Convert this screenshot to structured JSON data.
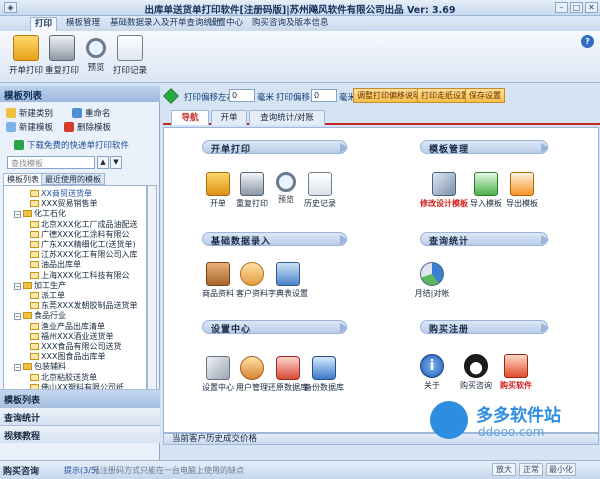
{
  "app": {
    "title": "出库单送货单打印软件[注册码版]|苏州飚风软件有限公司出品  Ver: 3.69"
  },
  "ribbon": {
    "tabs": [
      "打印",
      "模板管理",
      "基础数据录入及开单查询统计",
      "设置中心",
      "购买咨询及版本信息"
    ],
    "buttons": [
      {
        "label": "开单打印",
        "icon": "folder-print-icon"
      },
      {
        "label": "重复打印",
        "icon": "printer-icon"
      },
      {
        "label": "预览",
        "icon": "magnifier-icon"
      },
      {
        "label": "打印记录",
        "icon": "clipboard-icon"
      }
    ]
  },
  "left_panel": {
    "header": "模板列表",
    "actions": [
      "新建类别",
      "重命名",
      "新建模板",
      "删除模板"
    ],
    "download_link": "下载免费的快递单打印软件",
    "search_placeholder": "查找模板",
    "subtabs": [
      "模板列表",
      "最近使用的模板"
    ],
    "tree": [
      {
        "text": "XX商贸送货单",
        "level": 2,
        "type": "file"
      },
      {
        "text": "XXX贸易销售单",
        "level": 2,
        "type": "file"
      },
      {
        "text": "化工石化",
        "level": 1,
        "type": "folder"
      },
      {
        "text": "北京XXX化工厂成品油配送",
        "level": 2,
        "type": "file"
      },
      {
        "text": "广德XXX化工涂料有限公",
        "level": 2,
        "type": "file"
      },
      {
        "text": "广东XXX精细化工(送货单)",
        "level": 2,
        "type": "file"
      },
      {
        "text": "江苏XXX化工有限公司入库",
        "level": 2,
        "type": "file"
      },
      {
        "text": "油品出库单",
        "level": 2,
        "type": "file"
      },
      {
        "text": "上海XXX化工科技有限公",
        "level": 2,
        "type": "file"
      },
      {
        "text": "加工生产",
        "level": 1,
        "type": "folder"
      },
      {
        "text": "派工单",
        "level": 2,
        "type": "file"
      },
      {
        "text": "东莞XXX发朝胶制品送货单",
        "level": 2,
        "type": "file"
      },
      {
        "text": "食品行业",
        "level": 1,
        "type": "folder"
      },
      {
        "text": "渔业产品出库清单",
        "level": 2,
        "type": "file"
      },
      {
        "text": "福州XXX酒业送货单",
        "level": 2,
        "type": "file"
      },
      {
        "text": "XXX食品有限公司送货",
        "level": 2,
        "type": "file"
      },
      {
        "text": "XXX图食品出库单",
        "level": 2,
        "type": "file"
      },
      {
        "text": "包装辅料",
        "level": 1,
        "type": "folder"
      },
      {
        "text": "北京粘胶送货单",
        "level": 2,
        "type": "file"
      },
      {
        "text": "佛山XX塑料有限公司纸",
        "level": 2,
        "type": "file"
      }
    ],
    "sections": [
      "模板列表",
      "查询统计",
      "视频教程"
    ]
  },
  "print_options": {
    "left_right_label": "打印偏移左右",
    "left_right_value": "0",
    "up_down_label": "打印偏移上下",
    "up_down_value": "0",
    "unit": "毫米",
    "buttons": [
      "调整打印偏移说明",
      "打印走纸设置",
      "保存设置"
    ]
  },
  "main_tabs": [
    "导航",
    "开单",
    "查询统计/对账"
  ],
  "sections": {
    "kaidan": {
      "title": "开单打印",
      "items": [
        "开单",
        "重复打印",
        "预览",
        "历史记录"
      ]
    },
    "moban": {
      "title": "模板管理",
      "items": [
        "修改设计模板",
        "导入模板",
        "导出模板"
      ]
    },
    "jichu": {
      "title": "基础数据录入",
      "items": [
        "商品资料",
        "客户资料",
        "字典表设置"
      ]
    },
    "chaxun": {
      "title": "查询统计",
      "items": [
        "月结|对帐"
      ]
    },
    "shezhi": {
      "title": "设置中心",
      "items": [
        "设置中心",
        "用户管理",
        "还原数据库",
        "备份数据库"
      ]
    },
    "goumai": {
      "title": "购买注册",
      "items": [
        "关于",
        "购买咨询",
        "购买软件"
      ]
    }
  },
  "history_bar": "当前客户历史成交价格",
  "status": {
    "buy": "购买咨询",
    "tip_label": "提示(3/5)",
    "tip_text": "无注册码方式只能在一台电脑上使用的缺点",
    "zoom_buttons": [
      "放大",
      "正常",
      "最小化"
    ]
  },
  "watermark": {
    "name": "多多软件站",
    "url": "ddooo.com"
  }
}
